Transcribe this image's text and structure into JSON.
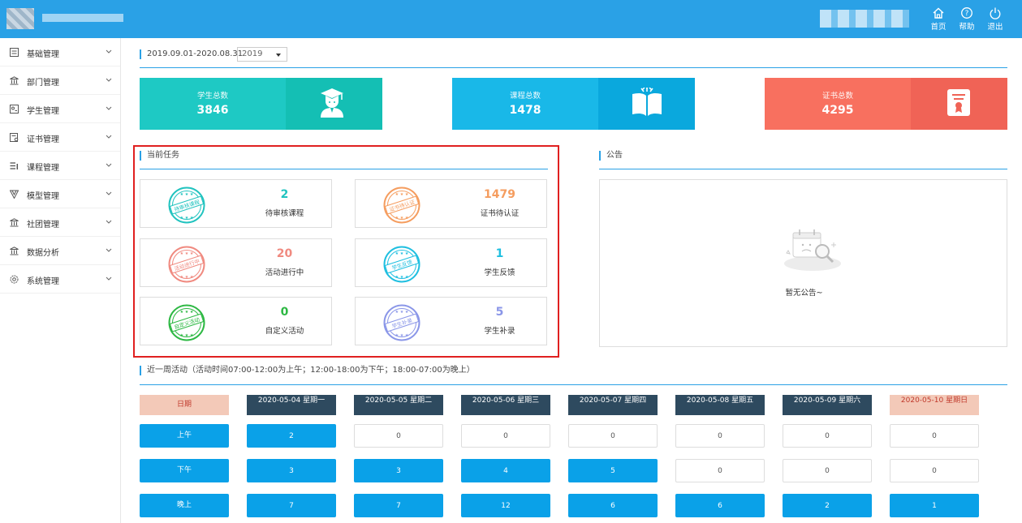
{
  "header": {
    "buttons": [
      {
        "label": "首页",
        "icon": "home-icon"
      },
      {
        "label": "帮助",
        "icon": "help-icon"
      },
      {
        "label": "退出",
        "icon": "power-icon"
      }
    ]
  },
  "sidebar": {
    "items": [
      {
        "label": "基础管理",
        "icon": "list-icon"
      },
      {
        "label": "部门管理",
        "icon": "building-icon"
      },
      {
        "label": "学生管理",
        "icon": "student-card-icon"
      },
      {
        "label": "证书管理",
        "icon": "certificate-icon"
      },
      {
        "label": "课程管理",
        "icon": "course-list-icon"
      },
      {
        "label": "模型管理",
        "icon": "model-icon"
      },
      {
        "label": "社团管理",
        "icon": "club-icon"
      },
      {
        "label": "数据分析",
        "icon": "analytics-icon"
      },
      {
        "label": "系统管理",
        "icon": "settings-icon"
      }
    ]
  },
  "period": {
    "range": "2019.09.01-2020.08.31",
    "year": "2019"
  },
  "stats": [
    {
      "label": "学生总数",
      "value": "3846",
      "color": "#1ec9c4",
      "icon": "graduate-icon"
    },
    {
      "label": "课程总数",
      "value": "1478",
      "color": "#19b8e8",
      "icon": "book-icon"
    },
    {
      "label": "证书总数",
      "value": "4295",
      "color": "#f8705f",
      "icon": "certificate-icon"
    }
  ],
  "tasks": {
    "title": "当前任务",
    "items": [
      {
        "stamp": "待审核课程",
        "value": "2",
        "label": "待审核课程",
        "color": "#21c3bf"
      },
      {
        "stamp": "证书待认证",
        "value": "1479",
        "label": "证书待认证",
        "color": "#f59d5f"
      },
      {
        "stamp": "活动进行中",
        "value": "20",
        "label": "活动进行中",
        "color": "#f08a80"
      },
      {
        "stamp": "学生反馈",
        "value": "1",
        "label": "学生反馈",
        "color": "#1fbfe0"
      },
      {
        "stamp": "自定义活动",
        "value": "0",
        "label": "自定义活动",
        "color": "#2db843"
      },
      {
        "stamp": "学生补录",
        "value": "5",
        "label": "学生补录",
        "color": "#8a96e8"
      }
    ]
  },
  "notice": {
    "title": "公告",
    "empty": "暂无公告~"
  },
  "week": {
    "title": "近一周活动（活动时间07:00-12:00为上午；12:00-18:00为下午；18:00-07:00为晚上）",
    "date_label": "日期",
    "days": [
      "2020-05-04 星期一",
      "2020-05-05 星期二",
      "2020-05-06 星期三",
      "2020-05-07 星期四",
      "2020-05-08 星期五",
      "2020-05-09 星期六",
      "2020-05-10 星期日"
    ],
    "rows": [
      {
        "label": "上午",
        "values": [
          "2",
          "0",
          "0",
          "0",
          "0",
          "0",
          "0"
        ]
      },
      {
        "label": "下午",
        "values": [
          "3",
          "3",
          "4",
          "5",
          "0",
          "0",
          "0"
        ]
      },
      {
        "label": "晚上",
        "values": [
          "7",
          "7",
          "12",
          "6",
          "6",
          "2",
          "1"
        ]
      }
    ]
  }
}
